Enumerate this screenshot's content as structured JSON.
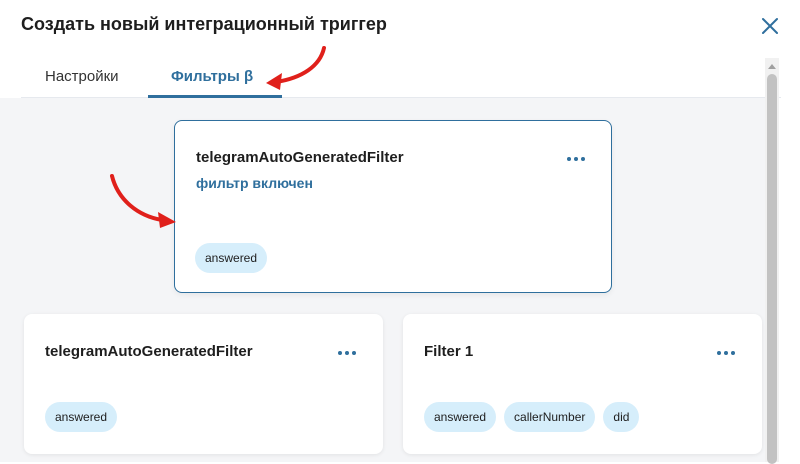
{
  "dialog": {
    "title": "Создать новый интеграционный триггер",
    "close_icon": "close-icon"
  },
  "tabs": [
    {
      "label": "Настройки",
      "active": false
    },
    {
      "label": "Фильтры β",
      "active": true
    }
  ],
  "colors": {
    "accent": "#2f6f9d",
    "tag_bg": "#d6eefb",
    "annotation_arrow": "#e0201b"
  },
  "filters": [
    {
      "name": "telegramAutoGeneratedFilter",
      "status": "фильтр включен",
      "tags": [
        "answered"
      ],
      "more_icon": "more-horizontal-icon"
    },
    {
      "name": "telegramAutoGeneratedFilter",
      "tags": [
        "answered"
      ],
      "more_icon": "more-horizontal-icon"
    },
    {
      "name": "Filter 1",
      "tags": [
        "answered",
        "callerNumber",
        "did"
      ],
      "more_icon": "more-horizontal-icon"
    }
  ]
}
